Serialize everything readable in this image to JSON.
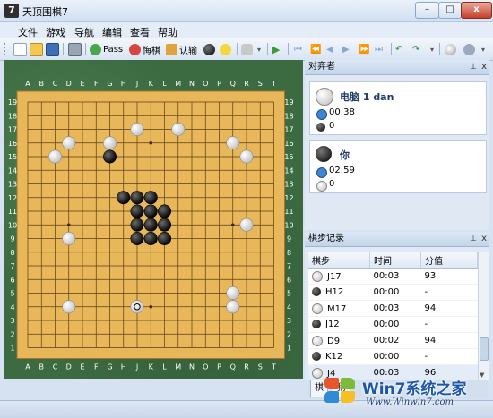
{
  "window": {
    "title": "天顶围棋7",
    "controls": {
      "minimize": "–",
      "maximize": "□",
      "close": "x"
    }
  },
  "menu": [
    "文件",
    "游戏",
    "导航",
    "编辑",
    "查看",
    "帮助"
  ],
  "toolbar": {
    "pass_label": "Pass",
    "undo_label": "悔棋",
    "resign_label": "认输"
  },
  "board": {
    "columns": [
      "A",
      "B",
      "C",
      "D",
      "E",
      "F",
      "G",
      "H",
      "J",
      "K",
      "L",
      "M",
      "N",
      "O",
      "P",
      "Q",
      "R",
      "S",
      "T"
    ],
    "rows": [
      "19",
      "18",
      "17",
      "16",
      "15",
      "14",
      "13",
      "12",
      "11",
      "10",
      "9",
      "8",
      "7",
      "6",
      "5",
      "4",
      "3",
      "2",
      "1"
    ],
    "stones": [
      {
        "color": "white",
        "pos": "J17"
      },
      {
        "color": "white",
        "pos": "M17"
      },
      {
        "color": "white",
        "pos": "D16"
      },
      {
        "color": "white",
        "pos": "G16"
      },
      {
        "color": "white",
        "pos": "Q16"
      },
      {
        "color": "white",
        "pos": "C15"
      },
      {
        "color": "white",
        "pos": "R15"
      },
      {
        "color": "white",
        "pos": "R10"
      },
      {
        "color": "white",
        "pos": "D9"
      },
      {
        "color": "white",
        "pos": "Q5"
      },
      {
        "color": "white",
        "pos": "D4"
      },
      {
        "color": "white",
        "pos": "Q4"
      },
      {
        "color": "white",
        "pos": "J4",
        "last": true
      },
      {
        "color": "black",
        "pos": "G15"
      },
      {
        "color": "black",
        "pos": "H12"
      },
      {
        "color": "black",
        "pos": "J12"
      },
      {
        "color": "black",
        "pos": "K12"
      },
      {
        "color": "black",
        "pos": "J11"
      },
      {
        "color": "black",
        "pos": "K11"
      },
      {
        "color": "black",
        "pos": "L11"
      },
      {
        "color": "black",
        "pos": "J10"
      },
      {
        "color": "black",
        "pos": "K10"
      },
      {
        "color": "black",
        "pos": "L10"
      },
      {
        "color": "black",
        "pos": "J9"
      },
      {
        "color": "black",
        "pos": "K9"
      },
      {
        "color": "black",
        "pos": "L9"
      }
    ]
  },
  "players_panel": {
    "title": "对弈者",
    "pin": "⊥",
    "close": "x",
    "players": [
      {
        "name": "电脑 1 dan",
        "stone": "white",
        "time": "00:38",
        "captures": "0",
        "capture_stone": "black"
      },
      {
        "name": "你",
        "stone": "black",
        "time": "02:59",
        "captures": "0",
        "capture_stone": "white"
      }
    ]
  },
  "moves_panel": {
    "title": "棋步记录",
    "pin": "⊥",
    "close": "x",
    "headers": [
      "棋步",
      "时间",
      "分值"
    ],
    "rows": [
      {
        "stone": "white",
        "move": "J17",
        "time": "00:03",
        "score": "93"
      },
      {
        "stone": "black",
        "move": "H12",
        "time": "00:00",
        "score": "-"
      },
      {
        "stone": "white",
        "move": "M17",
        "time": "00:03",
        "score": "94"
      },
      {
        "stone": "black",
        "move": "J12",
        "time": "00:00",
        "score": "-"
      },
      {
        "stone": "white",
        "move": "D9",
        "time": "00:02",
        "score": "94"
      },
      {
        "stone": "black",
        "move": "K12",
        "time": "00:00",
        "score": "-"
      },
      {
        "stone": "white",
        "move": "J4",
        "time": "00:03",
        "score": "96"
      }
    ]
  },
  "bottom_tabs": [
    "棋",
    "猜"
  ],
  "watermark": {
    "brand": "Win7系统之家",
    "url": "Www.Winwin7.com"
  },
  "colors": {
    "board": "#e8b75a",
    "felt": "#3c6a41",
    "accent": "#1f3a68"
  }
}
